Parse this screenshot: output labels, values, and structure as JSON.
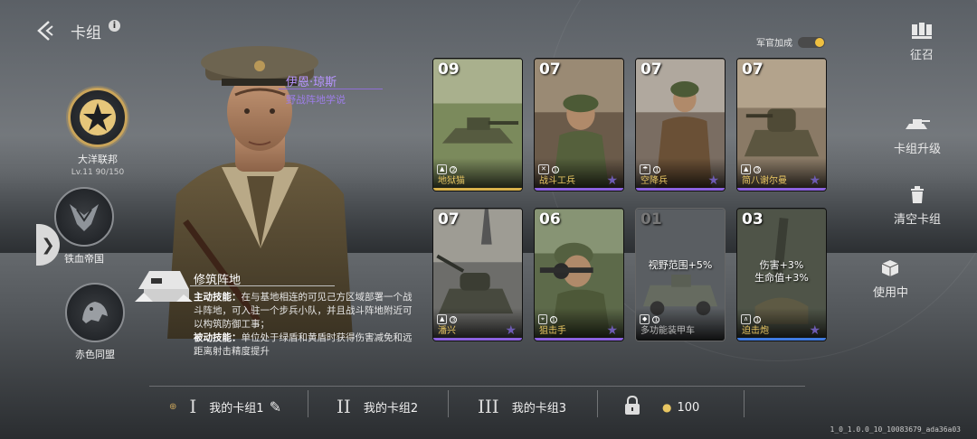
{
  "header": {
    "title": "卡组",
    "info_icon": "i"
  },
  "factions": [
    {
      "name": "大洋联邦",
      "level": "Lv.11",
      "progress": "90/150",
      "active": true
    },
    {
      "name": "铁血帝国",
      "active": false
    },
    {
      "name": "赤色同盟",
      "active": false
    }
  ],
  "commander": {
    "name": "伊恩·琼斯",
    "doctrine": "野战阵地学说"
  },
  "skill": {
    "title": "修筑阵地",
    "active_label": "主动技能：",
    "active_text": "在与基地相连的可见己方区域部署一个战斗阵地，可入驻一个步兵小队，并且战斗阵地附近可以构筑防御工事；",
    "passive_label": "被动技能：",
    "passive_text": "单位处于绿盾和黄盾时获得伤害减免和远距离射击精度提升"
  },
  "officer_bonus": {
    "label": "军官加成",
    "enabled": true
  },
  "cards": [
    {
      "cost": "09",
      "name": "地狱猫",
      "type": "tank",
      "count": "2",
      "rarity": "gold"
    },
    {
      "cost": "07",
      "name": "战斗工兵",
      "type": "infantry",
      "count": "1",
      "rarity": "purple"
    },
    {
      "cost": "07",
      "name": "空降兵",
      "type": "infantry",
      "count": "1",
      "rarity": "purple"
    },
    {
      "cost": "07",
      "name": "简八谢尔曼",
      "type": "tank",
      "count": "3",
      "rarity": "purple"
    },
    {
      "cost": "07",
      "name": "潘兴",
      "type": "tank",
      "count": "3",
      "rarity": "purple"
    },
    {
      "cost": "06",
      "name": "狙击手",
      "type": "infantry",
      "count": "1",
      "rarity": "purple"
    },
    {
      "cost": "01",
      "name": "多功能装甲车",
      "type": "vehicle",
      "count": "1",
      "rarity": "grey",
      "buff": "视野范围+5%"
    },
    {
      "cost": "03",
      "name": "迫击炮",
      "type": "artillery",
      "count": "1",
      "rarity": "blue",
      "buff": "伤害+3%\n生命值+3%"
    }
  ],
  "right_menu": [
    {
      "label": "征召",
      "icon": "recruit-icon"
    },
    {
      "label": "卡组升级",
      "icon": "upgrade-icon"
    },
    {
      "label": "清空卡组",
      "icon": "trash-icon"
    },
    {
      "label": "使用中",
      "icon": "box-icon"
    }
  ],
  "tabs": [
    {
      "numeral": "I",
      "label": "我的卡组1",
      "active": true
    },
    {
      "numeral": "II",
      "label": "我的卡组2",
      "active": false
    },
    {
      "numeral": "III",
      "label": "我的卡组3",
      "active": false
    }
  ],
  "currency": {
    "amount": "100"
  },
  "version": "1_0_1.0.0_10_10083679_ada36a03"
}
